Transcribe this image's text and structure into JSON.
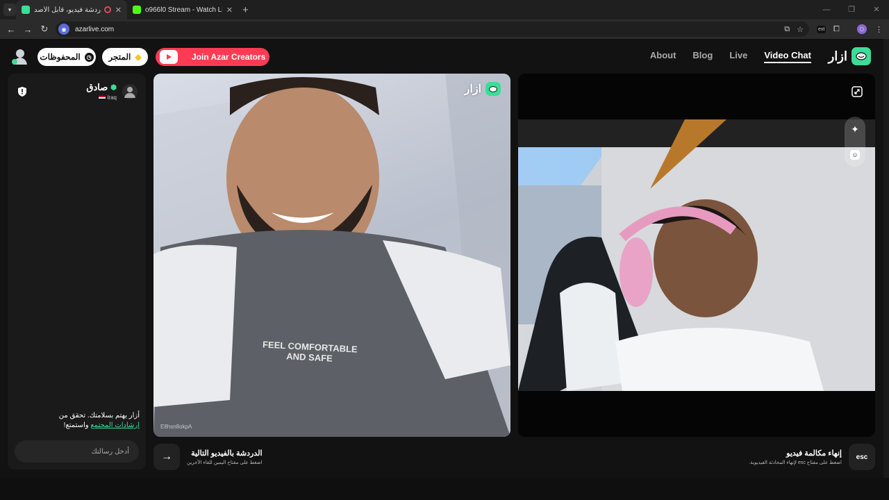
{
  "browser": {
    "tabs": [
      {
        "title": "أزار: دردشة فيديو، قابل الأصد",
        "active": true
      },
      {
        "title": "o966l0 Stream - Watch Live on",
        "active": false
      }
    ],
    "new_tab": "+",
    "url": "azarlive.com",
    "profile_letter": "O",
    "ext_badge": "ext"
  },
  "header": {
    "saved_label": "المحفوظات",
    "store_label": "المتجر",
    "creators_label": "Join Azar Creators",
    "nav": [
      "About",
      "Blog",
      "Live",
      "Video Chat"
    ],
    "brand": "ازار"
  },
  "chat": {
    "peer_name": "صادق",
    "peer_country": "Iraq",
    "notice_text": "أزار يهتم بسلامتك. تحقق من ",
    "notice_link": "إرشادات المجتمع",
    "notice_end": " واستمتع!",
    "input_placeholder": "أدخل رسالتك"
  },
  "video_left": {
    "watermark": "ازار",
    "user_id": "E8hsn8okpA",
    "shirt_line1": "FEEL COMFORTABLE",
    "shirt_line2": "AND SAFE"
  },
  "controls": {
    "next_title": "الدردشة بالفيديو التالية",
    "next_sub": "اضغط على مفتاح اليمين للقاء الآخرين",
    "end_title": "إنهاء مكالمة فيديو",
    "end_sub": "اضغط على مفتاح esc لإنهاء المحادثة الفيديوية.",
    "esc_label": "esc"
  },
  "colors": {
    "accent": "#3ddc97",
    "creators": "#ff3b54"
  }
}
